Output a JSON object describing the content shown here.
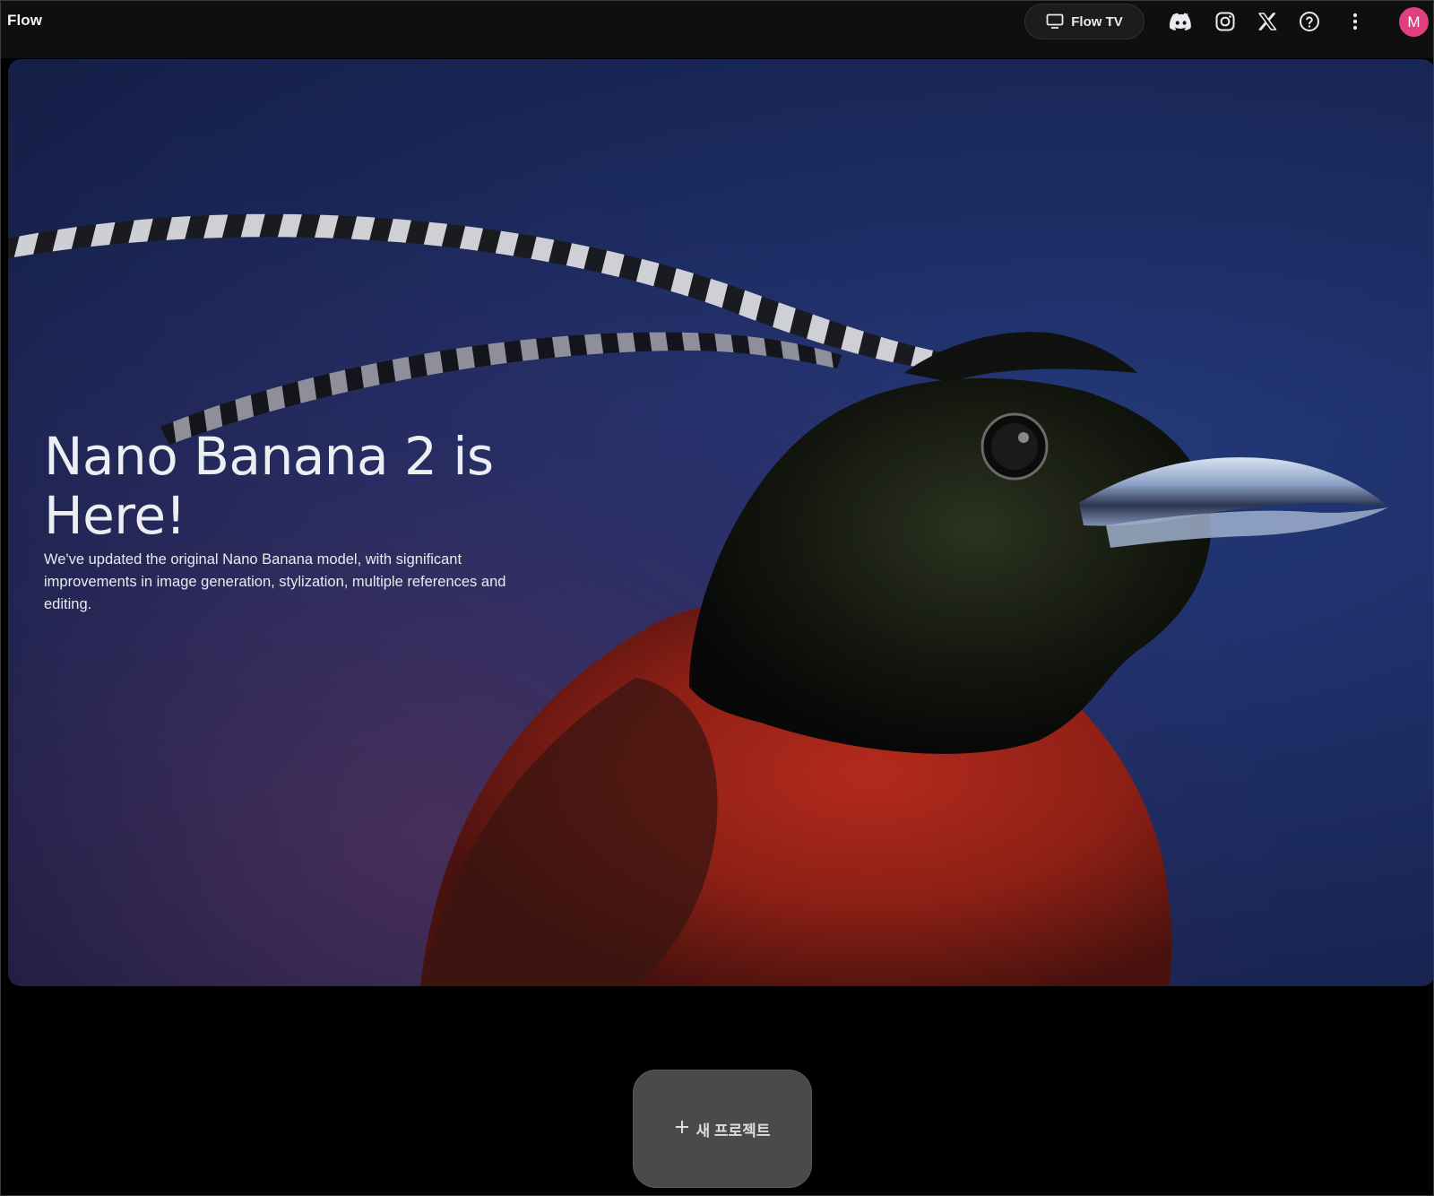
{
  "header": {
    "brand": "Flow",
    "flow_tv_label": "Flow TV",
    "icons": [
      "monitor-icon",
      "discord-icon",
      "instagram-icon",
      "x-icon",
      "help-icon",
      "more-vert-icon"
    ],
    "avatar_initial": "M",
    "avatar_color": "#e0407e"
  },
  "hero": {
    "title": "Nano Banana 2 is Here!",
    "description": "We've updated the original Nano Banana model, with significant improvements in image generation, stylization, multiple references and editing."
  },
  "actions": {
    "new_project_label": "새 프로젝트",
    "new_project_icon": "plus-icon"
  }
}
